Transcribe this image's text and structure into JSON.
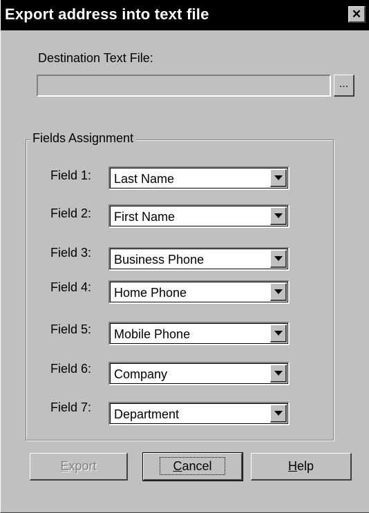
{
  "window": {
    "title": "Export address into text file",
    "close_glyph": "✕"
  },
  "destination": {
    "label": "Destination Text File:",
    "value": "",
    "browse_label": "..."
  },
  "fields_group": {
    "legend": "Fields Assignment",
    "fields": [
      {
        "label": "Field 1:",
        "value": "Last Name"
      },
      {
        "label": "Field 2:",
        "value": "First Name"
      },
      {
        "label": "Field 3:",
        "value": "Business Phone"
      },
      {
        "label": "Field 4:",
        "value": "Home Phone"
      },
      {
        "label": "Field 5:",
        "value": "Mobile Phone"
      },
      {
        "label": "Field 6:",
        "value": "Company"
      },
      {
        "label": "Field 7:",
        "value": "Department"
      }
    ]
  },
  "buttons": {
    "export": {
      "mnemonic": "E",
      "rest": "xport",
      "enabled": false
    },
    "cancel": {
      "mnemonic": "C",
      "rest": "ancel",
      "default": true
    },
    "help": {
      "mnemonic": "H",
      "rest": "elp"
    }
  },
  "colors": {
    "face": "#c0c0c0",
    "title_bar": "#000000",
    "title_text": "#ffffff",
    "disabled_text": "#808080"
  }
}
